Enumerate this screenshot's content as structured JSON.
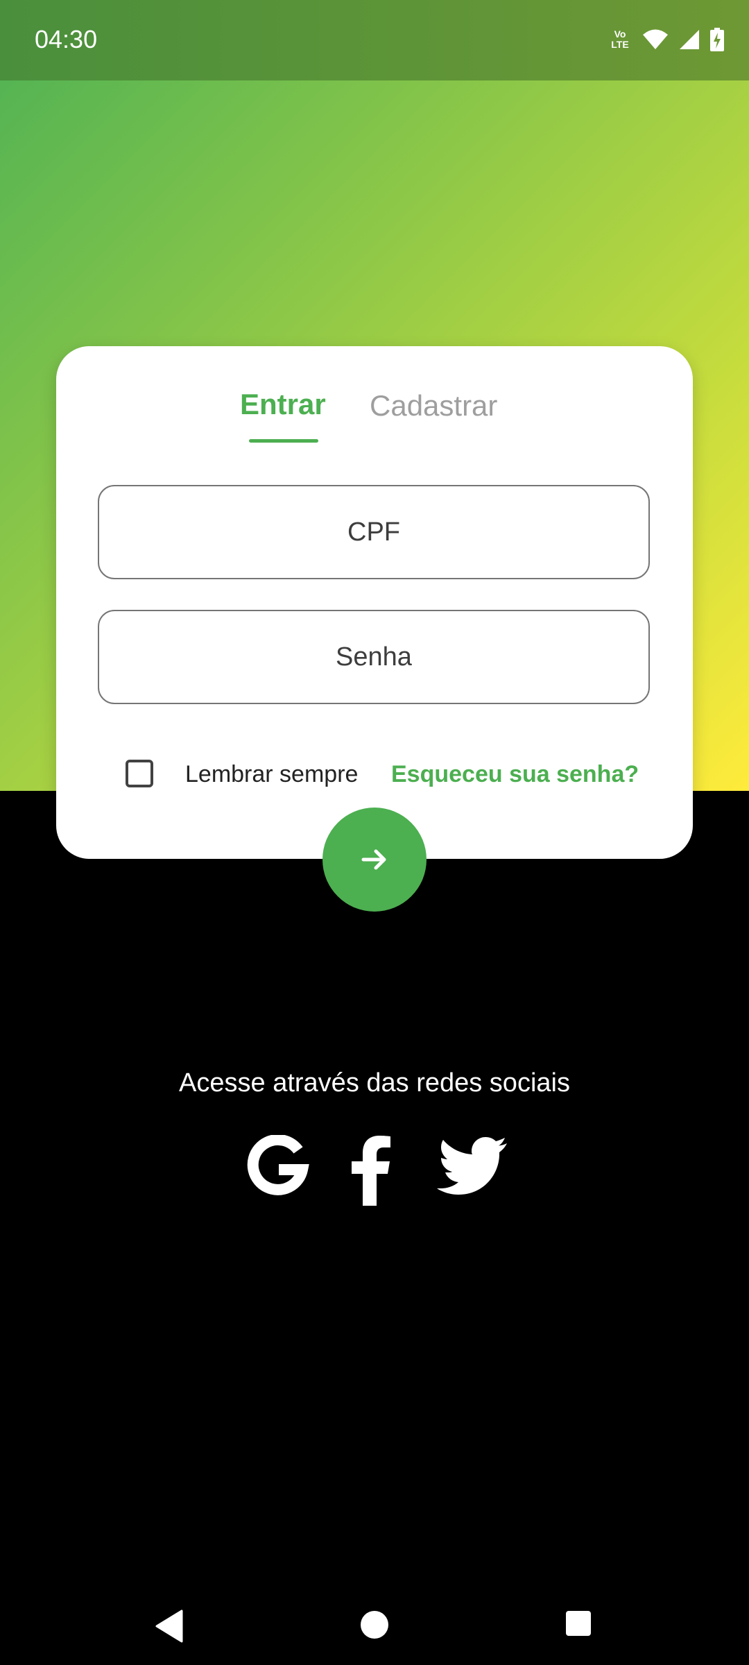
{
  "status_bar": {
    "time": "04:30",
    "volte_line1": "Vo",
    "volte_line2": "LTE",
    "icons": [
      "volte-icon",
      "wifi-icon",
      "signal-icon",
      "battery-charging-icon"
    ]
  },
  "login_card": {
    "tabs": [
      {
        "label": "Entrar",
        "active": true
      },
      {
        "label": "Cadastrar",
        "active": false
      }
    ],
    "cpf_placeholder": "CPF",
    "password_placeholder": "Senha",
    "remember_label": "Lembrar sempre",
    "remember_checked": false,
    "forgot_label": "Esqueceu sua senha?"
  },
  "submit": {
    "icon": "arrow-right-icon"
  },
  "social": {
    "title": "Acesse através das redes sociais",
    "icons": [
      "google-icon",
      "facebook-icon",
      "twitter-icon"
    ]
  },
  "navigation": {
    "icons": [
      "back-icon",
      "home-icon",
      "recents-icon"
    ]
  },
  "colors": {
    "accent": "#4caf50",
    "gradient_start": "#55b453",
    "gradient_end": "#ffeb3b",
    "background": "#000000"
  }
}
